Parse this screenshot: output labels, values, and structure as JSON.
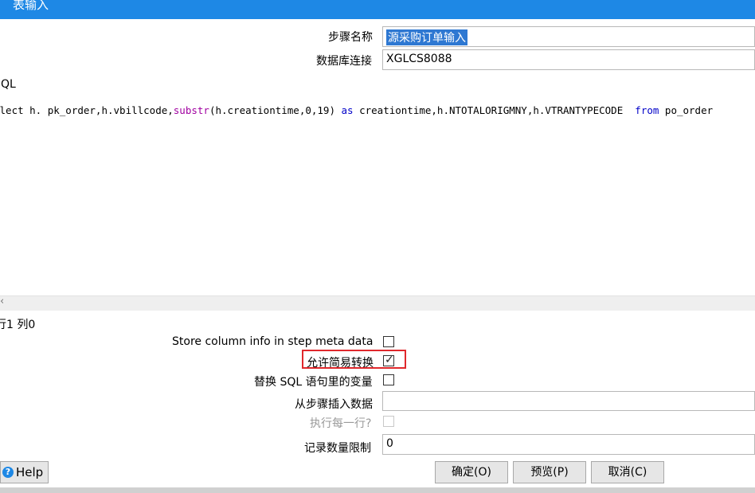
{
  "window": {
    "title": "表输入"
  },
  "form": {
    "step_name_label": "步骤名称",
    "step_name_value": "源采购订单输入",
    "db_conn_label": "数据库连接",
    "db_conn_value": "XGLCS8088",
    "sql_label": "QL"
  },
  "sql": {
    "t1": "elect h. pk_order,h.vbillcode,",
    "t2": "substr",
    "t3": "(h.creationtime,0,19) ",
    "t4": "as",
    "t5": " creationtime,h.NTOTALORIGMNY,h.VTRANTYPECODE  ",
    "t6": "from",
    "t7": " po_order"
  },
  "position_text": "行1 列0",
  "options": {
    "store_column_label": "Store column info in step meta data",
    "store_column_checked": false,
    "lazy_conversion_label": "允许简易转换",
    "lazy_conversion_checked": true,
    "replace_vars_label": "替换 SQL 语句里的变量",
    "replace_vars_checked": false,
    "insert_from_step_label": "从步骤插入数据",
    "insert_from_step_value": "",
    "execute_each_row_label": "执行每一行?",
    "execute_each_row_checked": false,
    "limit_label": "记录数量限制",
    "limit_value": "0"
  },
  "buttons": {
    "help": "Help",
    "ok": "确定(O)",
    "preview": "预览(P)",
    "cancel": "取消(C)"
  },
  "icons": {
    "help": "question-circle-icon",
    "check": "✓",
    "scroll_left": "‹"
  }
}
